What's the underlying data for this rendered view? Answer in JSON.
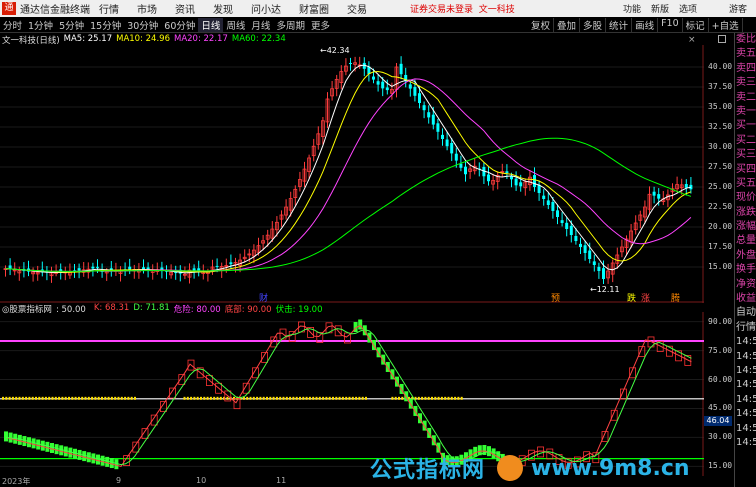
{
  "app": {
    "name": "通达信金融终端",
    "menu": [
      "行情",
      "市场",
      "资讯",
      "发现",
      "问小达",
      "财富圈",
      "交易"
    ],
    "notice": "证券交易未登录",
    "stock_title": "文一科技",
    "window_links": [
      "功能",
      "新版",
      "选项",
      "游客"
    ]
  },
  "toolbar": {
    "periods": [
      "分时",
      "1分钟",
      "5分钟",
      "15分钟",
      "30分钟",
      "60分钟",
      "日线",
      "周线",
      "月线",
      "多周期",
      "更多"
    ],
    "active_period": "日线",
    "tools": [
      "复权",
      "叠加",
      "多股",
      "统计",
      "画线",
      "F10",
      "标记",
      "+自选"
    ]
  },
  "main_chart": {
    "header_title": "文一科技(日线)",
    "ma5_label": "MA5: 25.17",
    "ma10_label": "MA10: 24.96",
    "ma20_label": "MA20: 22.17",
    "ma60_label": "MA60: 22.34",
    "high_label": "42.34",
    "low_label": "12.11",
    "price_axis": [
      "40.00",
      "37.50",
      "35.00",
      "32.50",
      "30.00",
      "27.50",
      "25.00",
      "22.50",
      "20.00",
      "17.50",
      "15.00"
    ],
    "marks": [
      "财",
      "预",
      "跌",
      "涨",
      "腾"
    ]
  },
  "sub_chart": {
    "name": "股票指标网",
    "value_label": ": 50.00",
    "k_label": "K: 68.31",
    "d_label": "D: 71.81",
    "danger_label": "危险: 80.00",
    "bottom_label": "底部: 90.00",
    "buy_label": "伏击: 19.00",
    "axis": [
      "90.00",
      "75.00",
      "60.00",
      "45.00",
      "30.00",
      "15.00"
    ],
    "current_value": "46.04"
  },
  "date_axis": [
    "2023年",
    "9",
    "10",
    "11"
  ],
  "right_panel": [
    "委比",
    "卖五",
    "卖四",
    "卖三",
    "卖二",
    "卖一",
    "买一",
    "买二",
    "买三",
    "买四",
    "买五",
    "现价",
    "涨跌",
    "涨幅",
    "总量",
    "外盘",
    "换手",
    "净资",
    "收益",
    "自动",
    "行情",
    "14:50",
    "14:50",
    "14:50",
    "14:50",
    "14:50",
    "14:50",
    "14:50",
    "14:50"
  ],
  "watermark": {
    "left_text": "公式指标网",
    "right_text": "www.9m8.cn"
  },
  "colors": {
    "up": "#ff3c3c",
    "down": "#00ffff",
    "ma5": "#ffffff",
    "ma10": "#ffff00",
    "ma20": "#ff44ff",
    "ma60": "#00ff00",
    "kline": "#ff4444",
    "dline": "#44ff44",
    "danger": "#ff44ff",
    "buy": "#00ff00"
  },
  "icons": [
    "app-logo-icon",
    "close-icon",
    "square-icon"
  ]
}
